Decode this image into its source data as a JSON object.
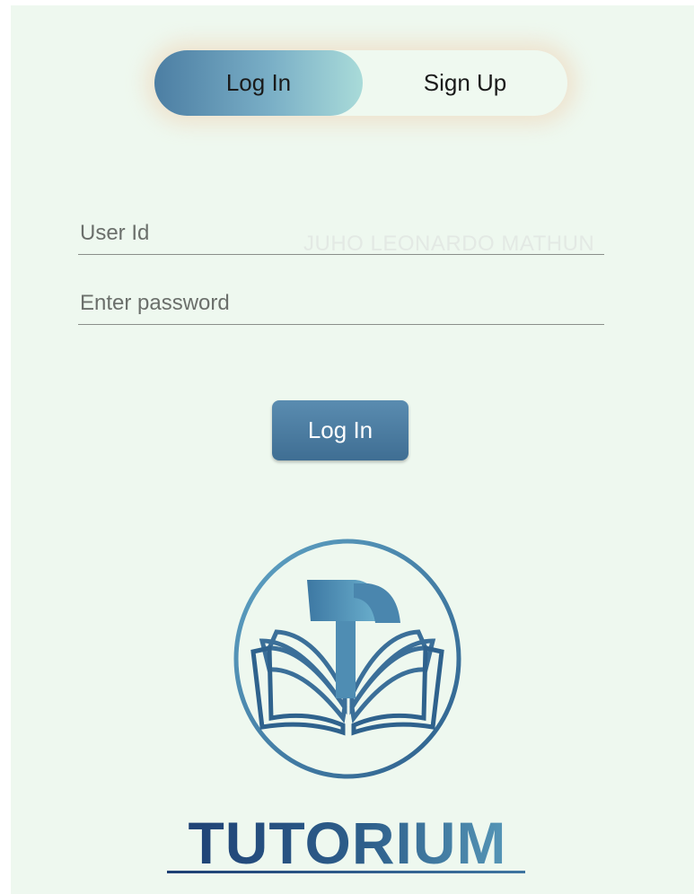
{
  "toggle": {
    "login_label": "Log In",
    "signup_label": "Sign Up",
    "active": "login"
  },
  "form": {
    "user_id": {
      "placeholder": "User Id",
      "value": ""
    },
    "password": {
      "placeholder": "Enter password",
      "value": ""
    },
    "background_text": "JUHO LEONARDO MATHUN",
    "submit_label": "Log In"
  },
  "brand": {
    "name": "TUTORIUM",
    "logo_icon": "book-t-circle-icon"
  },
  "colors": {
    "background": "#eef8ef",
    "accent": "#4a7ba0",
    "accent_light": "#a9dbd9",
    "brand_dark": "#1d3f73"
  }
}
